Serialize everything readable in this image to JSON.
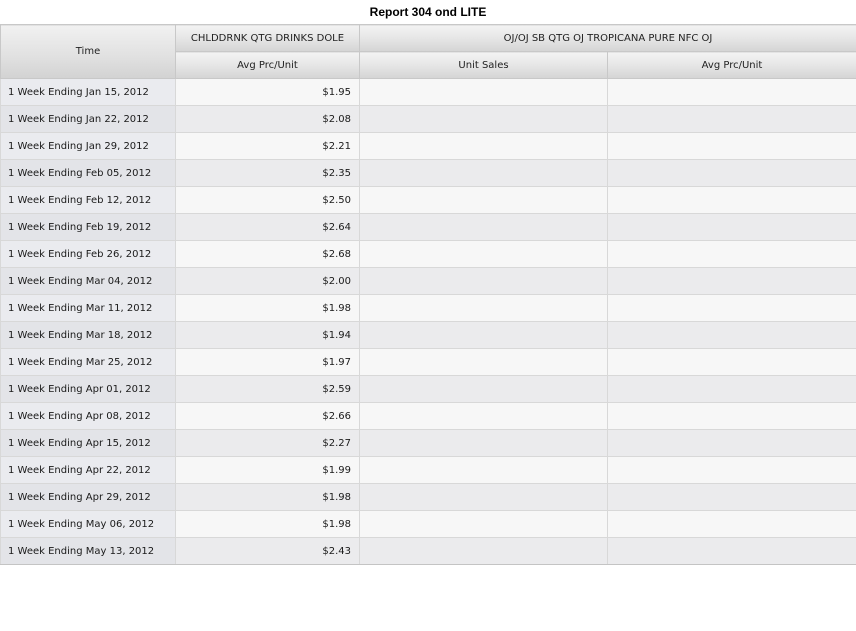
{
  "title": "Report 304 ond LITE",
  "table": {
    "time_header": "Time",
    "groups": [
      {
        "label": "CHLDDRNK QTG DRINKS DOLE"
      },
      {
        "label": "OJ/OJ SB QTG OJ TROPICANA PURE NFC OJ"
      }
    ],
    "subheaders": [
      "Avg Prc/Unit",
      "Unit Sales",
      "Avg Prc/Unit"
    ],
    "rows": [
      {
        "time": "1 Week Ending Jan 15, 2012",
        "dole_avg_price": "$1.95",
        "trop_unit_sales": "",
        "trop_avg_price": ""
      },
      {
        "time": "1 Week Ending Jan 22, 2012",
        "dole_avg_price": "$2.08",
        "trop_unit_sales": "",
        "trop_avg_price": ""
      },
      {
        "time": "1 Week Ending Jan 29, 2012",
        "dole_avg_price": "$2.21",
        "trop_unit_sales": "",
        "trop_avg_price": ""
      },
      {
        "time": "1 Week Ending Feb 05, 2012",
        "dole_avg_price": "$2.35",
        "trop_unit_sales": "",
        "trop_avg_price": ""
      },
      {
        "time": "1 Week Ending Feb 12, 2012",
        "dole_avg_price": "$2.50",
        "trop_unit_sales": "",
        "trop_avg_price": ""
      },
      {
        "time": "1 Week Ending Feb 19, 2012",
        "dole_avg_price": "$2.64",
        "trop_unit_sales": "",
        "trop_avg_price": ""
      },
      {
        "time": "1 Week Ending Feb 26, 2012",
        "dole_avg_price": "$2.68",
        "trop_unit_sales": "",
        "trop_avg_price": ""
      },
      {
        "time": "1 Week Ending Mar 04, 2012",
        "dole_avg_price": "$2.00",
        "trop_unit_sales": "",
        "trop_avg_price": ""
      },
      {
        "time": "1 Week Ending Mar 11, 2012",
        "dole_avg_price": "$1.98",
        "trop_unit_sales": "",
        "trop_avg_price": ""
      },
      {
        "time": "1 Week Ending Mar 18, 2012",
        "dole_avg_price": "$1.94",
        "trop_unit_sales": "",
        "trop_avg_price": ""
      },
      {
        "time": "1 Week Ending Mar 25, 2012",
        "dole_avg_price": "$1.97",
        "trop_unit_sales": "",
        "trop_avg_price": ""
      },
      {
        "time": "1 Week Ending Apr 01, 2012",
        "dole_avg_price": "$2.59",
        "trop_unit_sales": "",
        "trop_avg_price": ""
      },
      {
        "time": "1 Week Ending Apr 08, 2012",
        "dole_avg_price": "$2.66",
        "trop_unit_sales": "",
        "trop_avg_price": ""
      },
      {
        "time": "1 Week Ending Apr 15, 2012",
        "dole_avg_price": "$2.27",
        "trop_unit_sales": "",
        "trop_avg_price": ""
      },
      {
        "time": "1 Week Ending Apr 22, 2012",
        "dole_avg_price": "$1.99",
        "trop_unit_sales": "",
        "trop_avg_price": ""
      },
      {
        "time": "1 Week Ending Apr 29, 2012",
        "dole_avg_price": "$1.98",
        "trop_unit_sales": "",
        "trop_avg_price": ""
      },
      {
        "time": "1 Week Ending May 06, 2012",
        "dole_avg_price": "$1.98",
        "trop_unit_sales": "",
        "trop_avg_price": ""
      },
      {
        "time": "1 Week Ending May 13, 2012",
        "dole_avg_price": "$2.43",
        "trop_unit_sales": "",
        "trop_avg_price": ""
      }
    ]
  }
}
